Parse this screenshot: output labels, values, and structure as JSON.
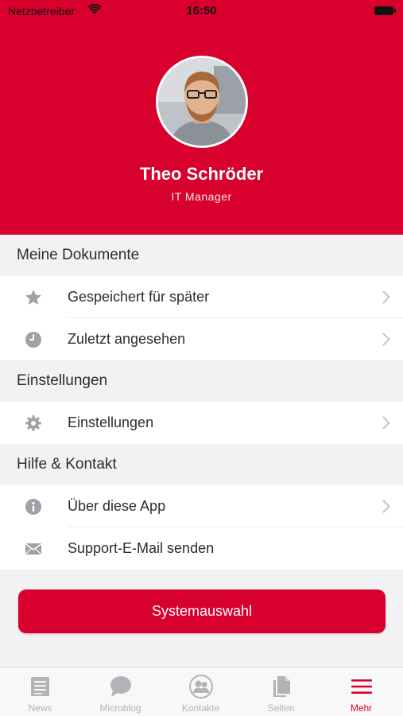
{
  "status_bar": {
    "carrier": "Netzbetreiber",
    "time": "16:50"
  },
  "profile": {
    "name": "Theo Schröder",
    "role": "IT Manager"
  },
  "sections": [
    {
      "title": "Meine Dokumente",
      "items": [
        {
          "label": "Gespeichert für später",
          "icon": "star-icon",
          "chevron": true
        },
        {
          "label": "Zuletzt angesehen",
          "icon": "clock-icon",
          "chevron": true
        }
      ]
    },
    {
      "title": "Einstellungen",
      "items": [
        {
          "label": "Einstellungen",
          "icon": "gear-icon",
          "chevron": true
        }
      ]
    },
    {
      "title": "Hilfe & Kontakt",
      "items": [
        {
          "label": "Über diese App",
          "icon": "info-icon",
          "chevron": true
        },
        {
          "label": "Support-E-Mail senden",
          "icon": "mail-icon",
          "chevron": false
        }
      ]
    }
  ],
  "primary_button": "Systemauswahl",
  "tabs": [
    {
      "label": "News",
      "icon": "news-icon",
      "active": false
    },
    {
      "label": "Microblog",
      "icon": "speech-bubble-icon",
      "active": false
    },
    {
      "label": "Kontakte",
      "icon": "contacts-icon",
      "active": false
    },
    {
      "label": "Seiten",
      "icon": "pages-icon",
      "active": false
    },
    {
      "label": "Mehr",
      "icon": "menu-icon",
      "active": true
    }
  ],
  "colors": {
    "brand": "#d8002d",
    "icon_gray": "#a0a0a8",
    "tab_inactive": "#b2b2b7"
  }
}
